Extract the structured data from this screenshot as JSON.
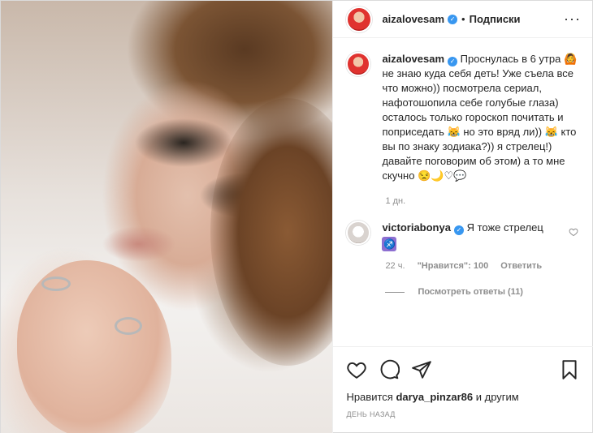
{
  "header": {
    "username": "aizalovesam",
    "separator": "•",
    "follow_label": "Подписки",
    "more_label": "···"
  },
  "caption": {
    "username": "aizalovesam",
    "text": "Проснулась в 6 утра 🙆 не знаю куда себя деть! Уже съела все что можно)) посмотрела сериал, нафотошопила себе голубые глаза) осталось только гороскоп почитать и поприседать 😹 но это вряд ли)) 😹 кто вы по знаку зодиака?)) я стрелец!) давайте поговорим об этом) а то мне скучно",
    "emojis": "😒🌙♡💬",
    "time": "1 дн."
  },
  "reply": {
    "username": "victoriabonya",
    "text": "Я тоже стрелец",
    "emoji": "♐",
    "time": "22 ч.",
    "likes": "\"Нравится\": 100",
    "reply_label": "Ответить"
  },
  "view_replies": "Посмотреть ответы (11)",
  "likes": {
    "prefix": "Нравится",
    "user": "darya_pinzar86",
    "suffix": "и другим"
  },
  "date": "ДЕНЬ НАЗАД",
  "icons": [
    "heart-icon",
    "comment-icon",
    "share-icon",
    "save-icon",
    "verified-icon",
    "more-icon"
  ],
  "colors": {
    "verified": "#3897f0",
    "text": "#262626",
    "muted": "#8e8e8e",
    "border": "#dbdbdb"
  }
}
